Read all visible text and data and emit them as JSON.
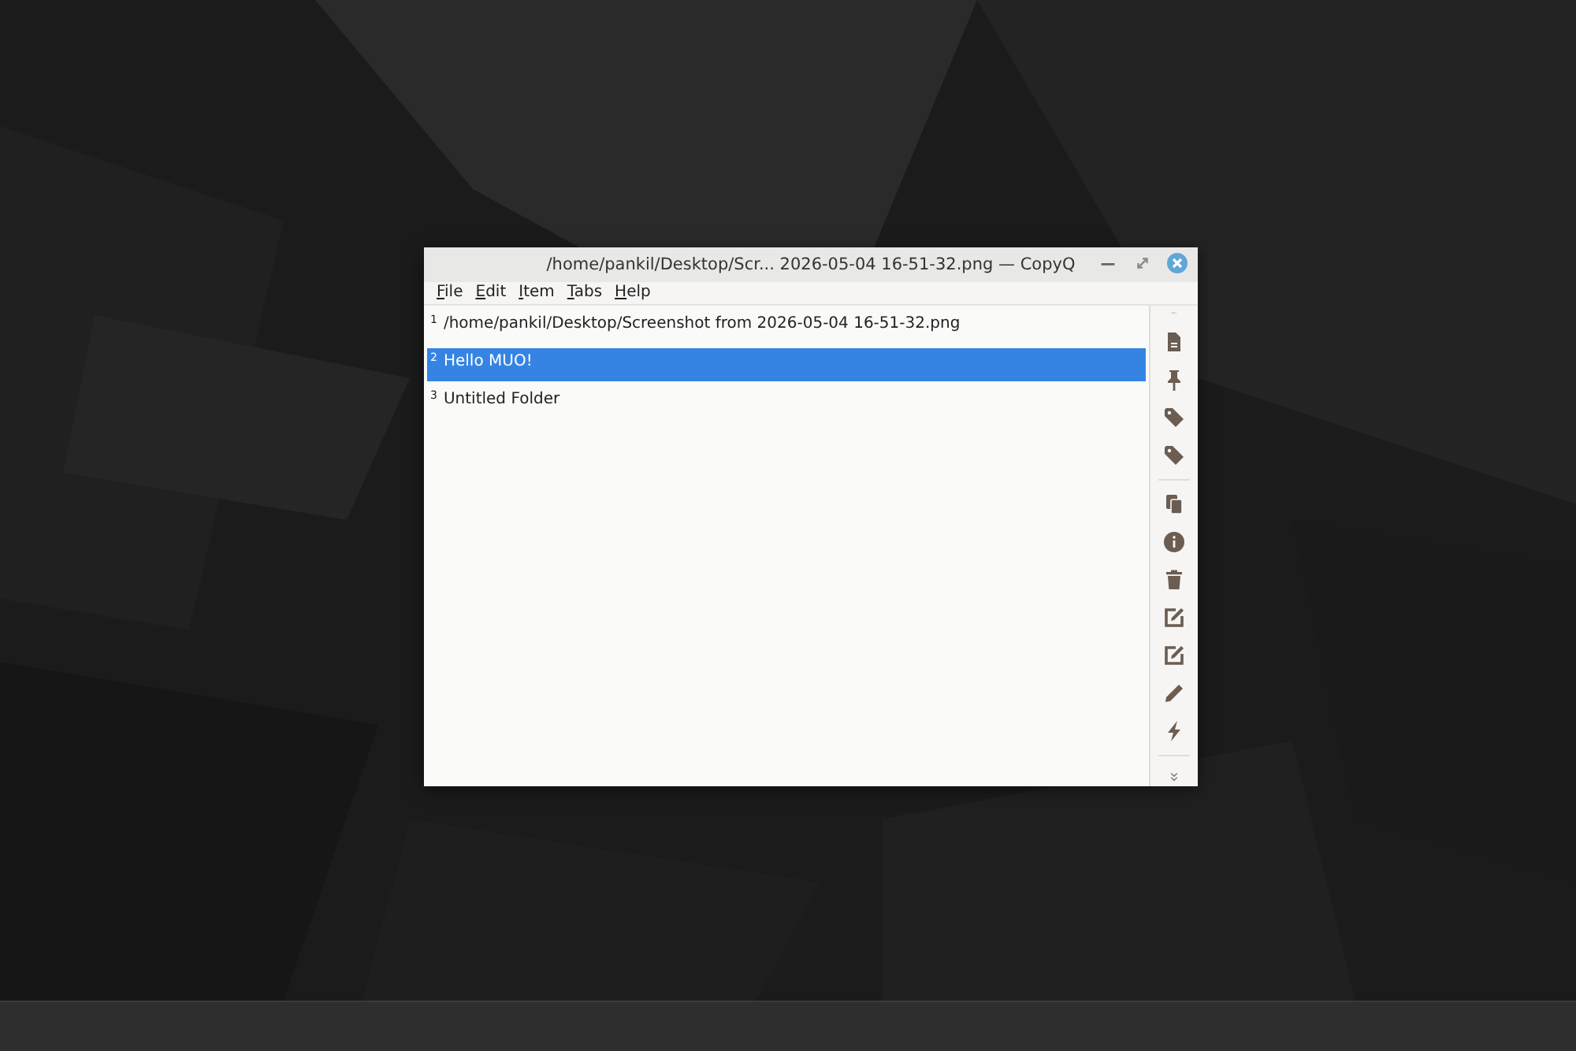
{
  "window": {
    "title": "/home/pankil/Desktop/Scr... 2026-05-04 16-51-32.png — CopyQ"
  },
  "menu": [
    "File",
    "Edit",
    "Item",
    "Tabs",
    "Help"
  ],
  "items": [
    {
      "number": "1",
      "text": "/home/pankil/Desktop/Screenshot from 2026-05-04 16-51-32.png",
      "selected": false
    },
    {
      "number": "2",
      "text": "Hello MUO!",
      "selected": true
    },
    {
      "number": "3",
      "text": "Untitled Folder",
      "selected": false
    }
  ]
}
